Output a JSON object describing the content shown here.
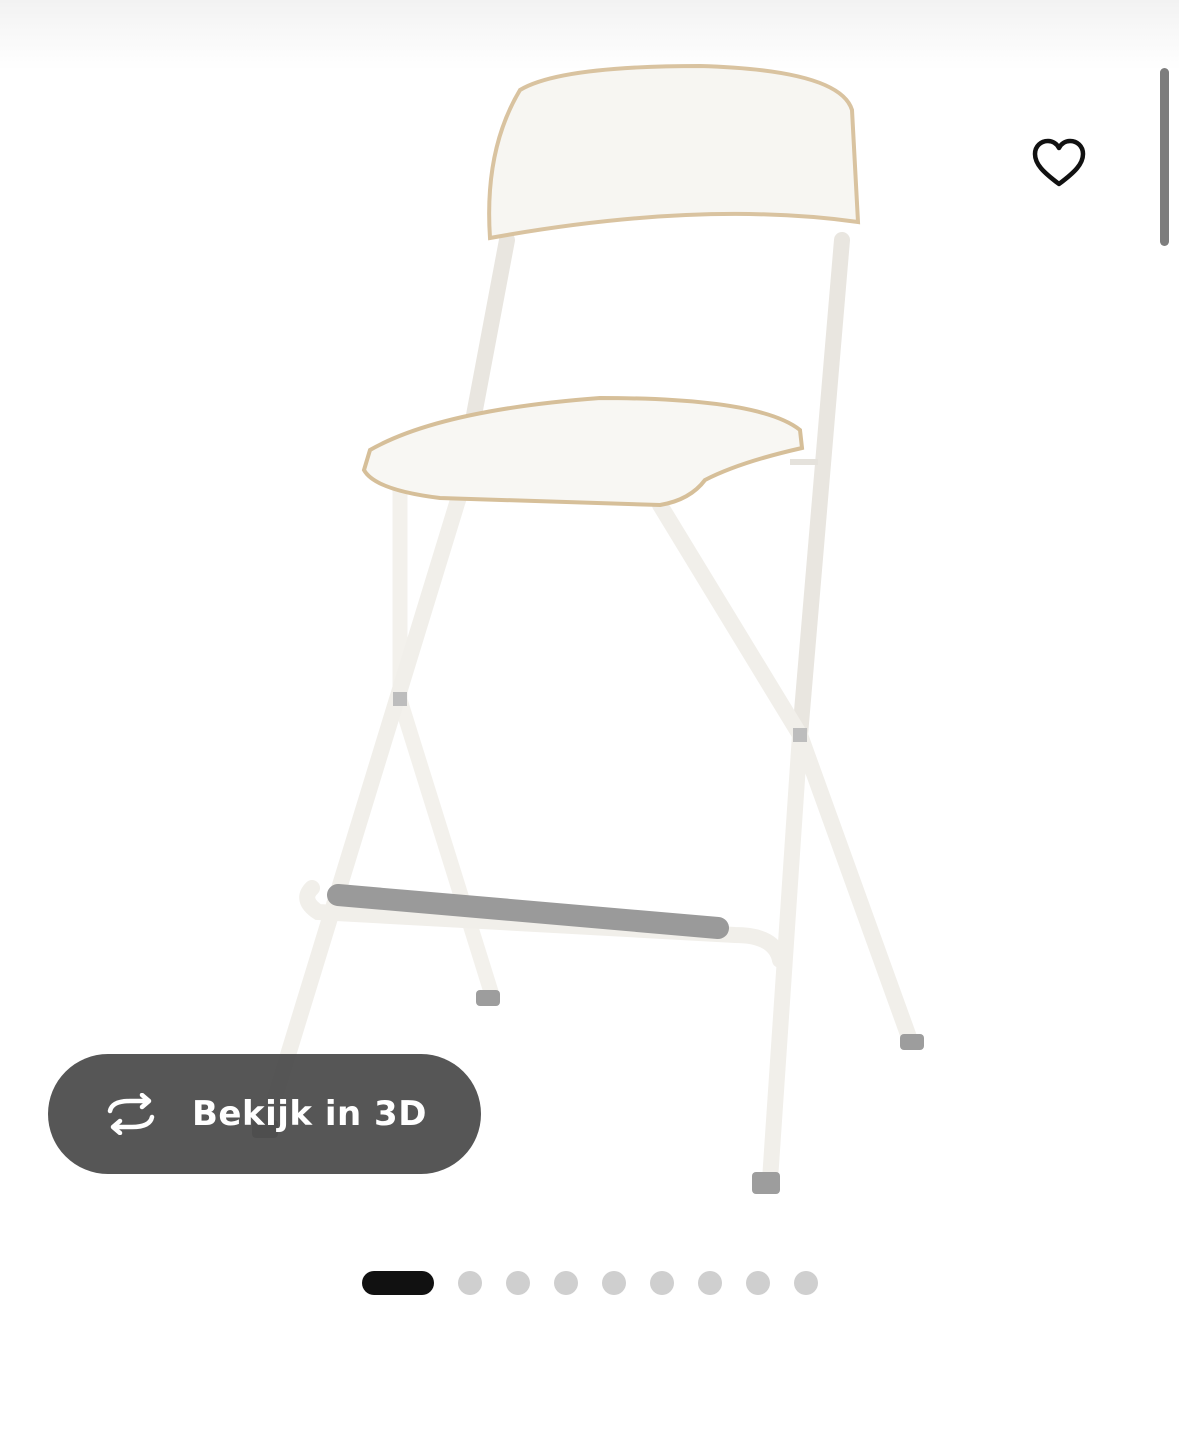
{
  "product_image": {
    "alt_icon": "bar-stool-image"
  },
  "favorite": {
    "icon": "heart-outline-icon"
  },
  "view_3d": {
    "label": "Bekijk in 3D",
    "icon": "rotate-3d-icon"
  },
  "carousel": {
    "total_slides": 9,
    "active_index": 0
  },
  "colors": {
    "button_bg": "#484848",
    "active_dot": "#111111",
    "inactive_dot": "#cfcfcf"
  }
}
